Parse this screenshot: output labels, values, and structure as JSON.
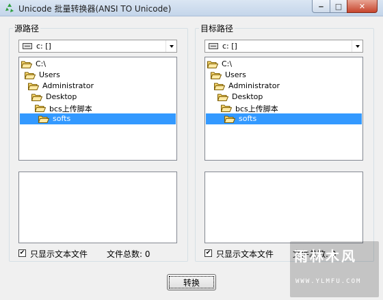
{
  "window": {
    "title": "Unicode 批量转换器(ANSI TO Unicode)",
    "controls": {
      "minimize": "‒",
      "maximize": "□",
      "close": "✕"
    }
  },
  "source_panel": {
    "label": "源路径",
    "drive": "c: []",
    "dirs": [
      {
        "name": "C:\\",
        "selected": false
      },
      {
        "name": "Users",
        "selected": false
      },
      {
        "name": "Administrator",
        "selected": false
      },
      {
        "name": "Desktop",
        "selected": false
      },
      {
        "name": "bcs上传脚本",
        "selected": false
      },
      {
        "name": "softs",
        "selected": true
      }
    ],
    "only_text_files_label": "只显示文本文件",
    "only_text_files_checked": true,
    "file_count_label": "文件总数: 0"
  },
  "target_panel": {
    "label": "目标路径",
    "drive": "c: []",
    "dirs": [
      {
        "name": "C:\\",
        "selected": false
      },
      {
        "name": "Users",
        "selected": false
      },
      {
        "name": "Administrator",
        "selected": false
      },
      {
        "name": "Desktop",
        "selected": false
      },
      {
        "name": "bcs上传脚本",
        "selected": false
      },
      {
        "name": "softs",
        "selected": true
      }
    ],
    "only_text_files_label": "只显示文本文件",
    "only_text_files_checked": true,
    "file_count_label": "文件总数: 0"
  },
  "convert_button_label": "转换",
  "watermark": {
    "logo": "雨林木风",
    "url": "WWW.YLMFU.COM"
  },
  "colors": {
    "selection": "#3399ff",
    "folder": "#f4d36b",
    "folder_open": "#ffe9a3"
  }
}
